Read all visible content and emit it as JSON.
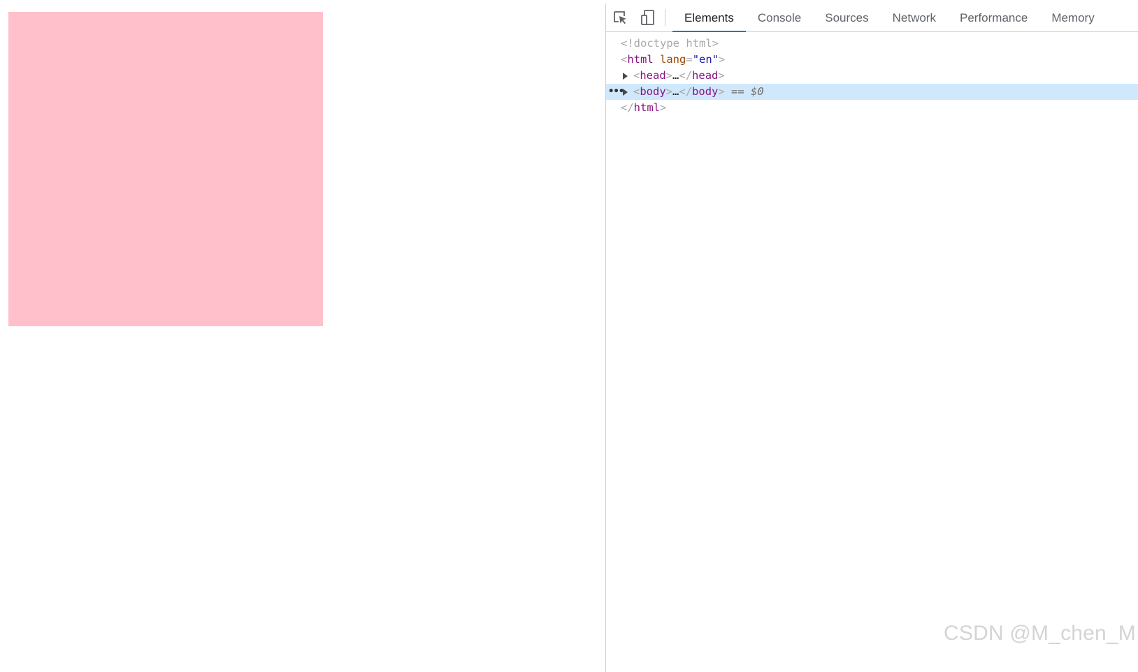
{
  "page": {
    "box_color": "#ffc0cb"
  },
  "devtools": {
    "tabs": [
      {
        "label": "Elements",
        "active": true
      },
      {
        "label": "Console",
        "active": false
      },
      {
        "label": "Sources",
        "active": false
      },
      {
        "label": "Network",
        "active": false
      },
      {
        "label": "Performance",
        "active": false
      },
      {
        "label": "Memory",
        "active": false
      }
    ],
    "icons": [
      "inspect-element-icon",
      "device-toolbar-icon"
    ],
    "dom": {
      "doctype": "<!doctype html>",
      "html_open": {
        "tag": "html",
        "attr": "lang",
        "value": "en"
      },
      "head": {
        "tag": "head",
        "ellipsis": "…"
      },
      "body": {
        "tag": "body",
        "ellipsis": "…",
        "console_ref": "== $0"
      },
      "html_close": "html",
      "menu_dots": "•••"
    },
    "accent_color": "#1a73e8",
    "selection_color": "#cfe8fc"
  },
  "watermark": "CSDN @M_chen_M"
}
